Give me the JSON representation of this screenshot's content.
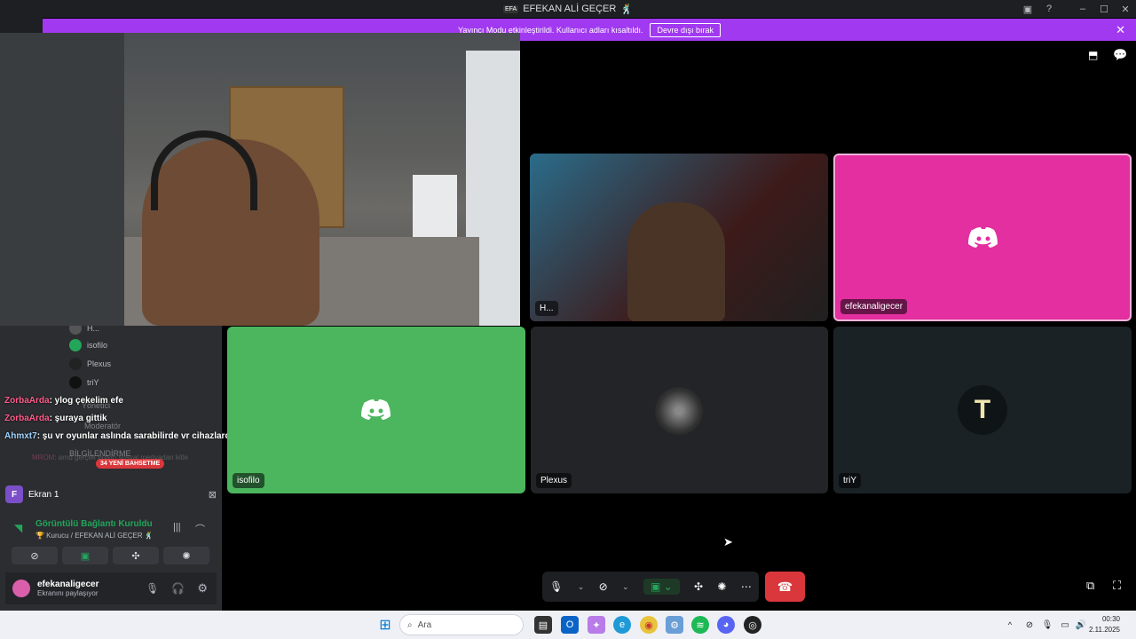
{
  "window": {
    "title": "EFEKAN ALİ GEÇER",
    "title_suffix": "🕺"
  },
  "banner": {
    "message": "Yayıncı Modu etkinleştirildi. Kullanıcı adları kısaltıldı.",
    "button": "Devre dışı bırak"
  },
  "channel_list": [
    {
      "name": "H..."
    },
    {
      "name": "isofilo"
    },
    {
      "name": "Plexus"
    },
    {
      "name": "triY"
    }
  ],
  "overlay_labels": {
    "yonetici": "Yönetici",
    "moderator": "Moderatör",
    "bilgilendirme": "BİLGİLENDİRME",
    "new_mentions": "34 YENİ BAHSETME"
  },
  "chat": [
    {
      "user": "ZorbaArda",
      "text": ": ylog çekelim efe"
    },
    {
      "user": "ZorbaArda",
      "text": ": şuraya gittik"
    },
    {
      "user": "Ahmxt7",
      "text": ": şu vr oyunlar aslında sarabilirde vr cihazlarda çok pahalı amk"
    }
  ],
  "ghost_chat": {
    "user": "MROM",
    "text": ": arnd gerçek bulyin sosyal medyadan kitle"
  },
  "voice_panel": {
    "screen": "Ekran 1",
    "screen_initial": "F",
    "connection": "Görüntülü Bağlantı Kuruldu",
    "connection_sub": "🏆 Kurucu / EFEKAN ALİ GEÇER 🕺"
  },
  "user": {
    "name": "efekanaligecer",
    "status": "Ekranını paylaşıyor"
  },
  "tiles": {
    "cam2_label": "H...",
    "tile_pink_label": "efekanaligecer",
    "tile_green_label": "isofilo",
    "tile_plexus_label": "Plexus",
    "tile_triy_label": "triY"
  },
  "taskbar": {
    "search_placeholder": "Ara",
    "time": "00:30",
    "date": "2.11.2025"
  },
  "colors": {
    "pink": "#e32f9f",
    "green": "#4cb65f",
    "banner": "#a139f0",
    "hangup": "#da373c"
  }
}
